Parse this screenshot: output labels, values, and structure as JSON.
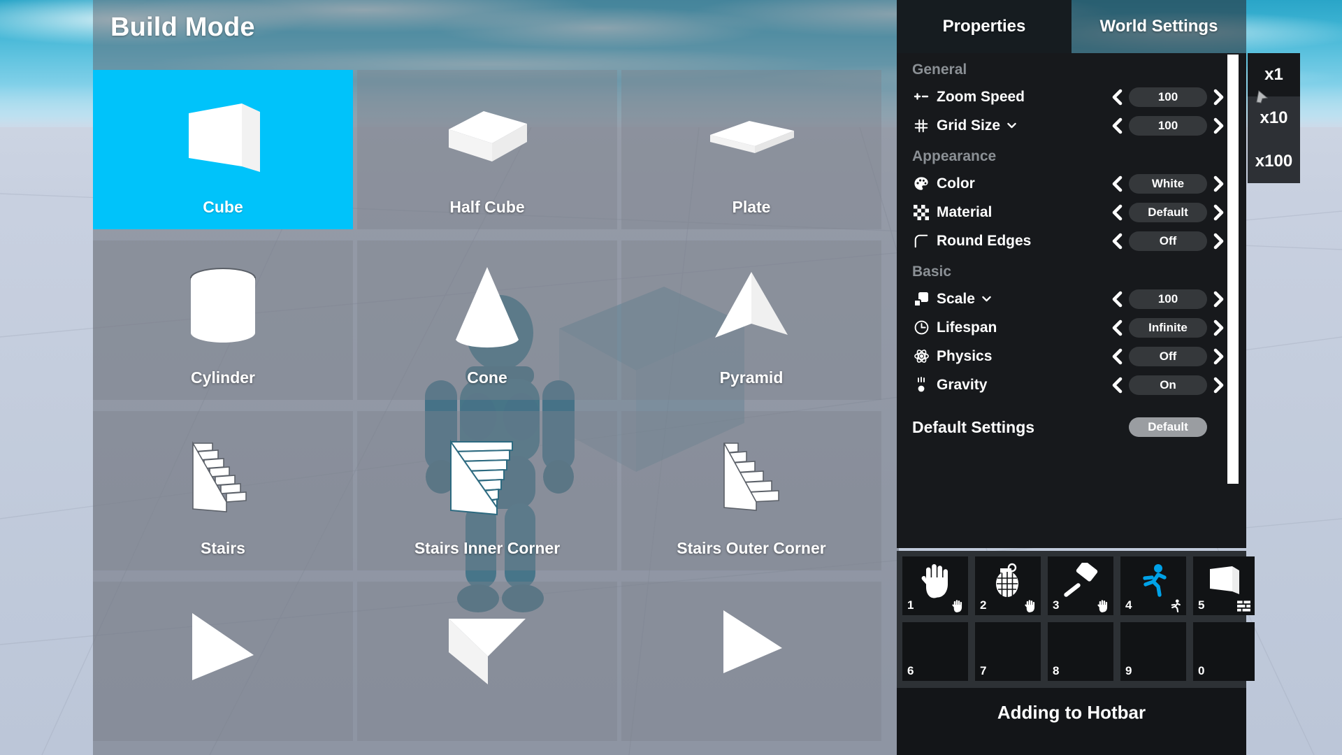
{
  "scene": {
    "sky_color": "#62c4e0",
    "ground_color": "#c4cddd",
    "avatar_color": "#2e86a0",
    "ghost_block_color": "#5a9fb8"
  },
  "build": {
    "title": "Build Mode",
    "selected_index": 0,
    "selected_color": "#00c3fa",
    "tiles": [
      {
        "label": "Cube",
        "art": "cube",
        "selected": true
      },
      {
        "label": "Half Cube",
        "art": "half-cube",
        "selected": false
      },
      {
        "label": "Plate",
        "art": "plate",
        "selected": false
      },
      {
        "label": "Cylinder",
        "art": "cylinder",
        "selected": false
      },
      {
        "label": "Cone",
        "art": "cone",
        "selected": false
      },
      {
        "label": "Pyramid",
        "art": "pyramid",
        "selected": false
      },
      {
        "label": "Stairs",
        "art": "stairs",
        "selected": false
      },
      {
        "label": "Stairs Inner Corner",
        "art": "stairs-inner",
        "selected": false
      },
      {
        "label": "Stairs Outer Corner",
        "art": "stairs-outer",
        "selected": false
      },
      {
        "label": "",
        "art": "wedge",
        "selected": false
      },
      {
        "label": "",
        "art": "wedge-2",
        "selected": false
      },
      {
        "label": "",
        "art": "wedge-3",
        "selected": false
      }
    ]
  },
  "properties": {
    "tabs": [
      {
        "label": "Properties",
        "active": true
      },
      {
        "label": "World Settings",
        "active": false
      }
    ],
    "sections": [
      {
        "heading": "General",
        "rows": [
          {
            "icon": "plus-minus-icon",
            "label": "Zoom Speed",
            "value": "100",
            "dropdown": false
          },
          {
            "icon": "grid-icon",
            "label": "Grid Size",
            "value": "100",
            "dropdown": true
          }
        ]
      },
      {
        "heading": "Appearance",
        "rows": [
          {
            "icon": "palette-icon",
            "label": "Color",
            "value": "White",
            "dropdown": false
          },
          {
            "icon": "checker-icon",
            "label": "Material",
            "value": "Default",
            "dropdown": false
          },
          {
            "icon": "round-edge-icon",
            "label": "Round Edges",
            "value": "Off",
            "dropdown": false
          }
        ]
      },
      {
        "heading": "Basic",
        "rows": [
          {
            "icon": "scale-icon",
            "label": "Scale",
            "value": "100",
            "dropdown": true
          },
          {
            "icon": "clock-icon",
            "label": "Lifespan",
            "value": "Infinite",
            "dropdown": false
          },
          {
            "icon": "atom-icon",
            "label": "Physics",
            "value": "Off",
            "dropdown": false
          },
          {
            "icon": "gravity-icon",
            "label": "Gravity",
            "value": "On",
            "dropdown": false
          }
        ]
      }
    ],
    "default_settings": {
      "label": "Default Settings",
      "button": "Default"
    },
    "arrow_left": "chevron-left-icon",
    "arrow_right": "chevron-right-icon"
  },
  "multipliers": [
    {
      "label": "x1",
      "active": true
    },
    {
      "label": "x10",
      "active": false
    },
    {
      "label": "x100",
      "active": false
    }
  ],
  "hotbar": {
    "status": "Adding to Hotbar",
    "slots": [
      {
        "key": "1",
        "art": "hand-icon",
        "mini": "hand-icon",
        "color": "#ffffff"
      },
      {
        "key": "2",
        "art": "grenade-icon",
        "mini": "hand-icon",
        "color": "#ffffff"
      },
      {
        "key": "3",
        "art": "hammer-icon",
        "mini": "hand-icon",
        "color": "#ffffff"
      },
      {
        "key": "4",
        "art": "runner-icon",
        "mini": "runner-icon",
        "color": "#00a2e8"
      },
      {
        "key": "5",
        "art": "cube-icon",
        "mini": "bricks-icon",
        "color": "#ffffff"
      },
      {
        "key": "6",
        "art": "",
        "mini": "",
        "color": "#ffffff"
      },
      {
        "key": "7",
        "art": "",
        "mini": "",
        "color": "#ffffff"
      },
      {
        "key": "8",
        "art": "",
        "mini": "",
        "color": "#ffffff"
      },
      {
        "key": "9",
        "art": "",
        "mini": "",
        "color": "#ffffff"
      },
      {
        "key": "0",
        "art": "",
        "mini": "",
        "color": "#ffffff"
      }
    ]
  }
}
